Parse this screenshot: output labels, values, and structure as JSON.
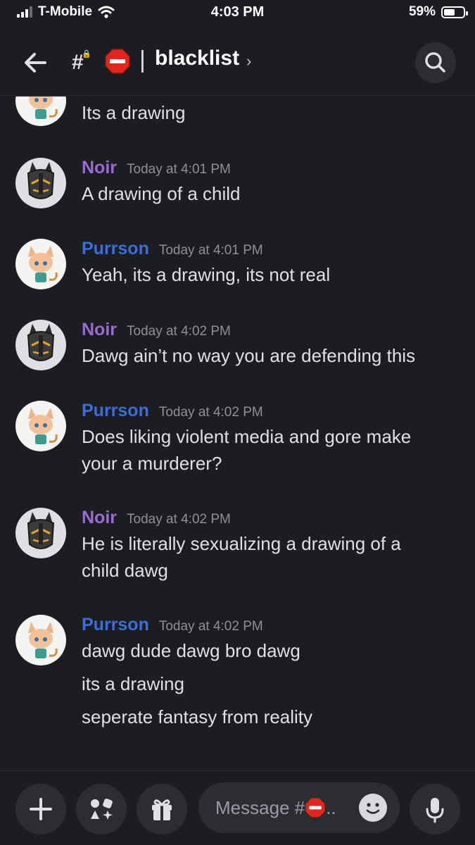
{
  "status_bar": {
    "carrier": "T-Mobile",
    "time": "4:03 PM",
    "battery": "59%",
    "battery_level": 0.59
  },
  "header": {
    "channel_name": "blacklist",
    "hash": "#",
    "separator": "|",
    "chevron": "›"
  },
  "messages": [
    {
      "lines": [
        "Its a drawing"
      ]
    },
    {
      "author": "Noir",
      "timestamp": "Today at 4:01 PM",
      "lines": [
        "A drawing of a child"
      ]
    },
    {
      "author": "Purrson",
      "timestamp": "Today at 4:01 PM",
      "lines": [
        "Yeah, its a drawing, its not real"
      ]
    },
    {
      "author": "Noir",
      "timestamp": "Today at 4:02 PM",
      "lines": [
        "Dawg ain’t no way you are defending this"
      ]
    },
    {
      "author": "Purrson",
      "timestamp": "Today at 4:02 PM",
      "lines": [
        "Does liking violent media and gore make",
        "your a murderer?"
      ]
    },
    {
      "author": "Noir",
      "timestamp": "Today at 4:02 PM",
      "lines": [
        "He is literally sexualizing a drawing of a",
        "child dawg"
      ]
    },
    {
      "author": "Purrson",
      "timestamp": "Today at 4:02 PM",
      "lines": [
        "dawg dude dawg bro dawg",
        "its a drawing",
        "seperate fantasy from reality"
      ]
    }
  ],
  "composer": {
    "placeholder": "Message #",
    "ellipsis": ".."
  },
  "icons": {
    "back": "arrow-left-icon",
    "channel": "locked-hash-icon",
    "channel_emoji": "stop-sign-icon",
    "search": "search-icon",
    "add": "plus-icon",
    "apps": "apps-icon",
    "gift": "gift-icon",
    "emoji": "emoji-icon",
    "mic": "microphone-icon"
  },
  "colors": {
    "background": "#1c1d22",
    "noir_name": "#9b6ad3",
    "purrson_name": "#3a6ed6",
    "timestamp": "#8e9097",
    "button_bg": "#2b2d33",
    "stop_red": "#e0261d"
  }
}
